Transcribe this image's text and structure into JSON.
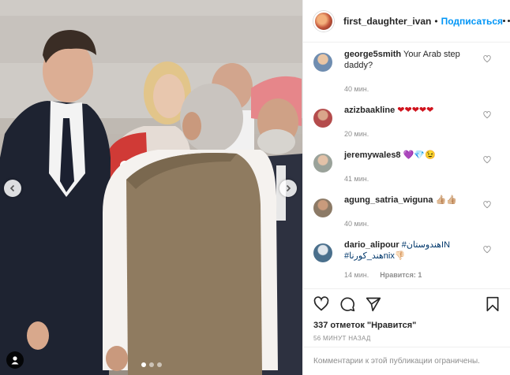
{
  "post": {
    "username": "first_daughter_ivan",
    "separator": "•",
    "follow_label": "Подписаться",
    "carousel": {
      "total_slides": 3,
      "active_slide": 1
    }
  },
  "comments": [
    {
      "user": "george5smith",
      "text": "Your Arab step daddy?",
      "time": "40 мин.",
      "reply": "",
      "avatar_color": "#6f8db0"
    },
    {
      "user": "azizbaakline",
      "text": "❤❤❤❤❤",
      "time": "20 мин.",
      "reply": "",
      "avatar_color": "#b44c4c"
    },
    {
      "user": "jeremywales8",
      "text": "💜💎😉",
      "time": "41 мин.",
      "reply": "",
      "avatar_color": "#9aa29a"
    },
    {
      "user": "agung_satria_wiguna",
      "text": "👍🏼👍🏼",
      "time": "40 мин.",
      "reply": "",
      "avatar_color": "#8c7a66"
    },
    {
      "user": "dario_alipour",
      "text_before": "",
      "hashtag1": "#هندوستان",
      "hashtag1_suffix": "IN",
      "hashtag2": "#هند_کورنا",
      "hashtag2_suffix": "nix👎🏻",
      "time": "14 мин.",
      "reply": "Нравится: 1",
      "avatar_color": "#4a6f8c"
    }
  ],
  "actions": {
    "likes": "337 отметок \"Нравится\"",
    "timestamp": "56 МИНУТ НАЗАД",
    "comments_limited": "Комментарии к этой публикации ограничены."
  },
  "icons": [
    "chevron-left-icon",
    "chevron-right-icon",
    "person-tag-icon",
    "more-icon",
    "heart-icon",
    "comment-icon",
    "share-icon",
    "bookmark-icon"
  ]
}
